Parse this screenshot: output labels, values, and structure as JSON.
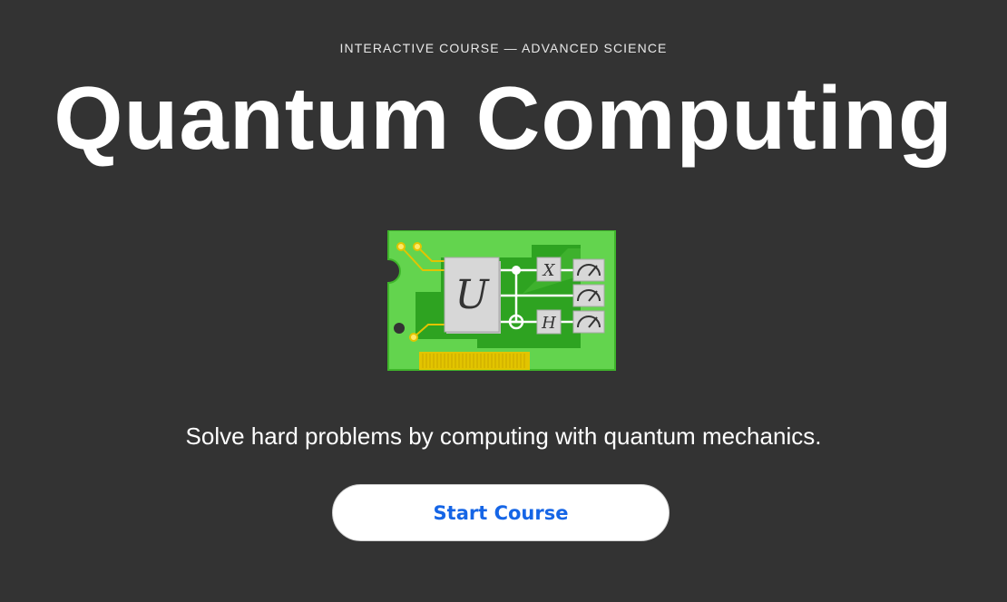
{
  "header": {
    "eyebrow": "INTERACTIVE COURSE — ADVANCED SCIENCE",
    "title": "Quantum Computing"
  },
  "illustration": {
    "icon": "quantum-circuit-chip-icon",
    "gate_unitary": "U",
    "gate_x": "X",
    "gate_h": "H",
    "colors": {
      "board": "#63d44e",
      "trace": "#2ea321",
      "gold": "#e2c400",
      "gate": "#d7d7d7"
    }
  },
  "main": {
    "tagline": "Solve hard problems by computing with quantum mechanics.",
    "cta_label": "Start Course"
  },
  "colors": {
    "background": "#333333",
    "cta_text": "#1565e6"
  }
}
